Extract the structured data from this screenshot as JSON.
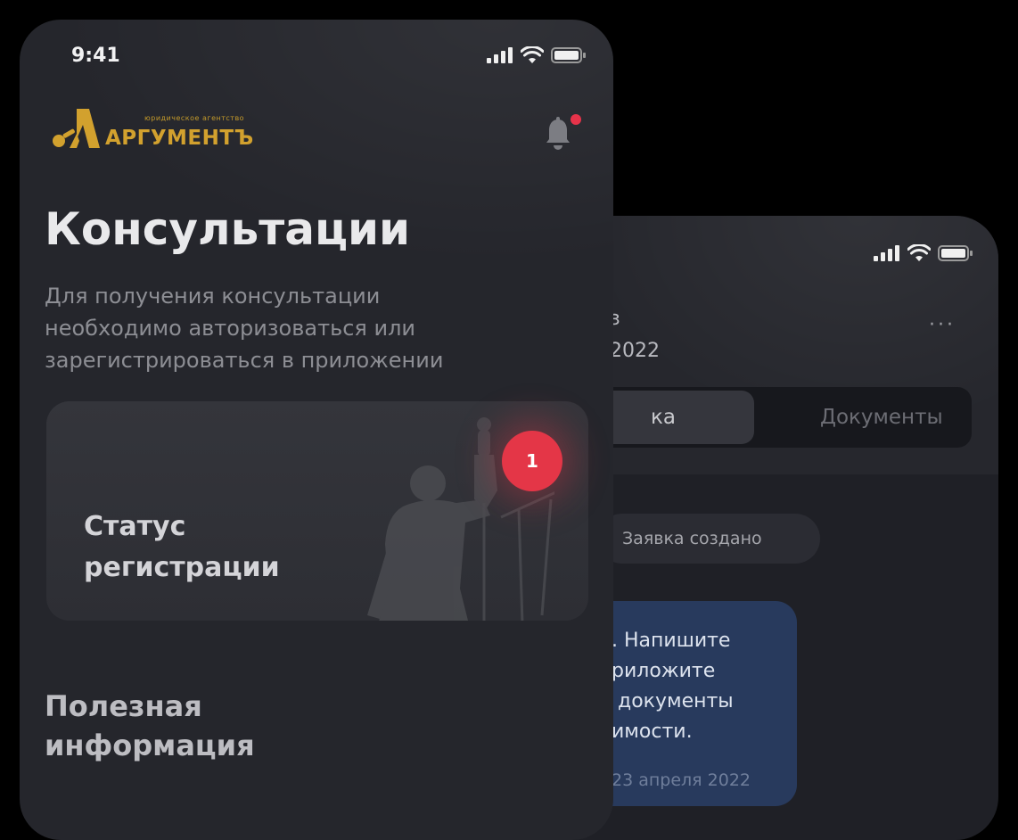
{
  "back_screen": {
    "subtitle_lines": [
      "з",
      "2022"
    ],
    "more_label": "···",
    "tabs": {
      "active_label": "ка",
      "docs_label": "Документы"
    },
    "status_chip": "Заявка создано",
    "message": {
      "text": ". Напишите\nриложите\n документы\nимости.",
      "date": "23  апреля 2022"
    }
  },
  "front_screen": {
    "status_bar": {
      "time": "9:41"
    },
    "logo": {
      "caption": "юридическое агентство",
      "name": "АРГУМЕНТЪ"
    },
    "title": "Консультации",
    "description": "Для получения консультации необходимо авторизоваться или зарегистрироваться в приложении",
    "registration_card": {
      "title": "Статус регистрации",
      "badge_count": "1"
    },
    "useful_info_title": "Полезная информация"
  },
  "colors": {
    "background": "#000000",
    "phone": "#25262c",
    "logo_gold": "#d2a12e",
    "badge_red": "#e43647",
    "message_blue": "#283a5d"
  },
  "icons": [
    "cellular-signal-icon",
    "wifi-icon",
    "battery-icon",
    "bell-icon",
    "notification-dot-icon",
    "justice-statue-icon",
    "more-dots-icon"
  ]
}
